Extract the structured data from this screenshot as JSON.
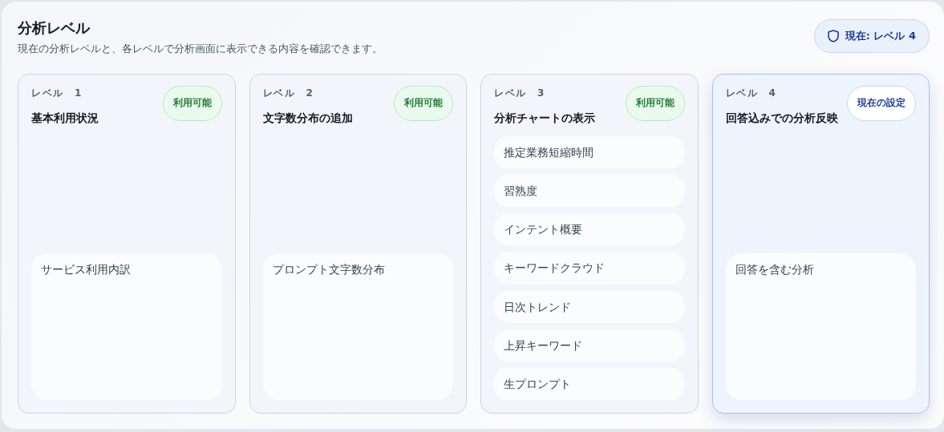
{
  "header": {
    "title": "分析レベル",
    "subtitle": "現在の分析レベルと、各レベルで分析画面に表示できる内容を確認できます。",
    "current_badge": "現在: レベル 4"
  },
  "levels": [
    {
      "label": "レベル　1",
      "title": "基本利用状況",
      "badge": "利用可能",
      "kind": "available",
      "selected": false,
      "items": [
        "サービス利用内訳"
      ]
    },
    {
      "label": "レベル　2",
      "title": "文字数分布の追加",
      "badge": "利用可能",
      "kind": "available",
      "selected": false,
      "items": [
        "プロンプト文字数分布"
      ]
    },
    {
      "label": "レベル　3",
      "title": "分析チャートの表示",
      "badge": "利用可能",
      "kind": "available",
      "selected": false,
      "items": [
        "推定業務短縮時間",
        "習熟度",
        "インテント概要",
        "キーワードクラウド",
        "日次トレンド",
        "上昇キーワード",
        "生プロンプト"
      ]
    },
    {
      "label": "レベル　4",
      "title": "回答込みでの分析反映",
      "badge": "現在の設定",
      "kind": "current",
      "selected": true,
      "items": [
        "回答を含む分析"
      ]
    }
  ]
}
